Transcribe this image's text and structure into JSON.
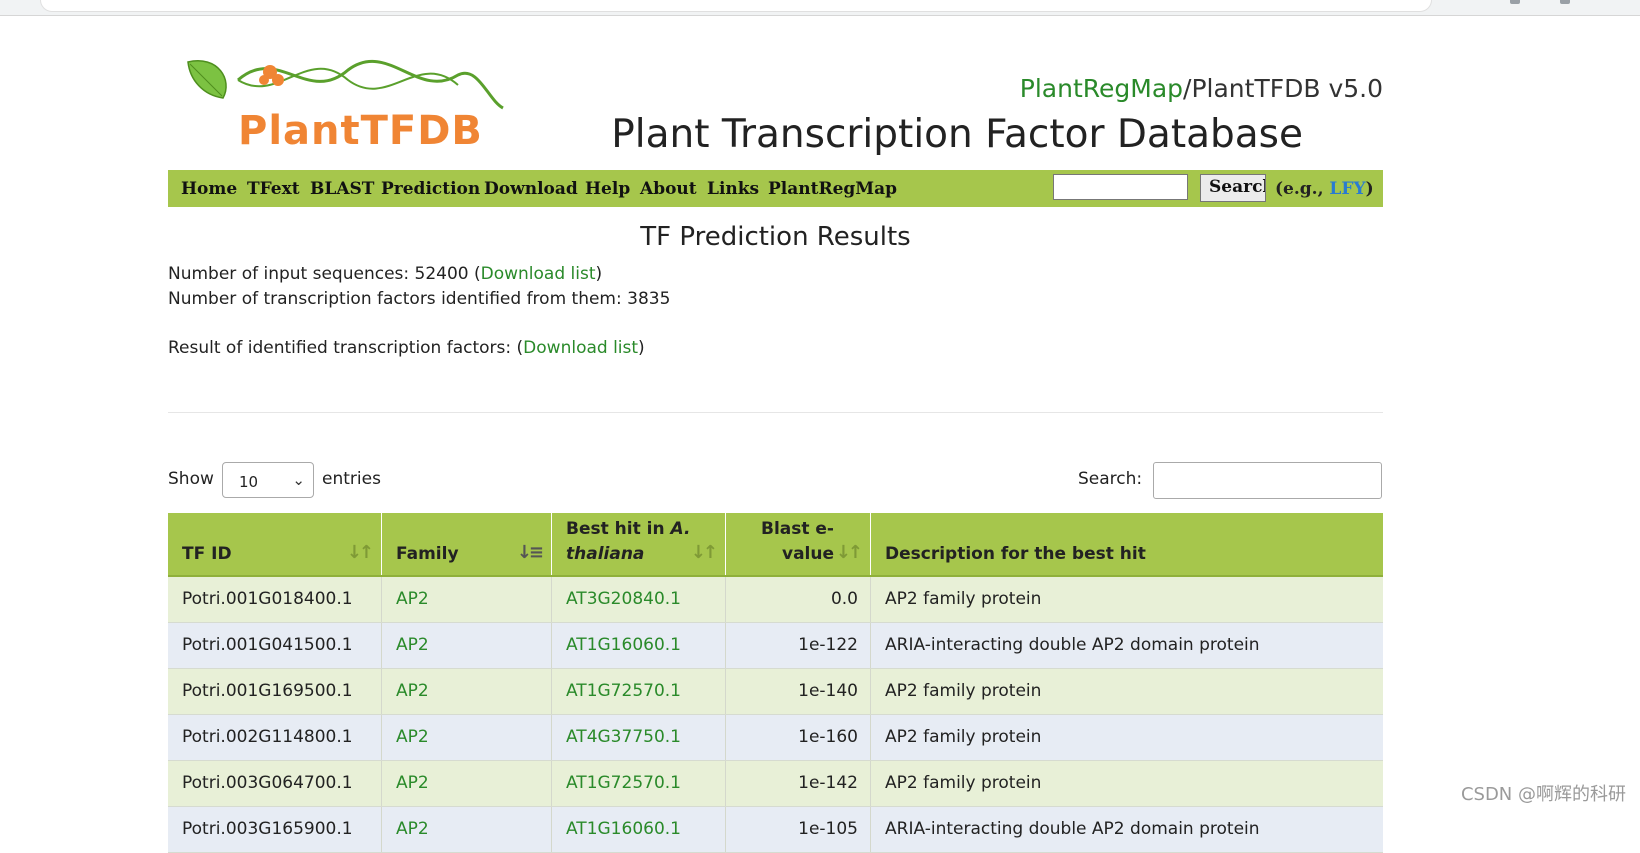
{
  "header": {
    "logo_text": "PlantTFDB",
    "site_link": "PlantRegMap",
    "site_suffix": "/PlantTFDB v5.0",
    "title": "Plant Transcription Factor Database"
  },
  "nav": {
    "items": [
      "Home",
      "TFext",
      "BLAST",
      "Prediction",
      "Download",
      "Help",
      "About",
      "Links",
      "PlantRegMap"
    ],
    "search_button": "Search",
    "example_prefix": "(e.g., ",
    "example_link": "LFY",
    "example_suffix": ")"
  },
  "main": {
    "heading": "TF Prediction Results",
    "input_seq_prefix": "Number of input sequences: 52400 (",
    "download_list": "Download list",
    "close_paren": ")",
    "tf_identified": "Number of transcription factors identified from them: 3835",
    "result_prefix": "Result of identified transcription factors: ("
  },
  "table_controls": {
    "show_label": "Show",
    "entries_value": "10",
    "entries_label": "entries",
    "search_label": "Search:"
  },
  "table": {
    "headers": {
      "tf_id": "TF ID",
      "family": "Family",
      "best_hit_line1": "Best hit in ",
      "best_hit_italic1": "A.",
      "best_hit_italic2": "thaliana",
      "blast_line1": "Blast e-",
      "blast_line2": "value",
      "description": "Description for the best hit"
    },
    "rows": [
      {
        "tf_id": "Potri.001G018400.1",
        "family": "AP2",
        "best_hit": "AT3G20840.1",
        "evalue": "0.0",
        "description": "AP2 family protein"
      },
      {
        "tf_id": "Potri.001G041500.1",
        "family": "AP2",
        "best_hit": "AT1G16060.1",
        "evalue": "1e-122",
        "description": "ARIA-interacting double AP2 domain protein"
      },
      {
        "tf_id": "Potri.001G169500.1",
        "family": "AP2",
        "best_hit": "AT1G72570.1",
        "evalue": "1e-140",
        "description": "AP2 family protein"
      },
      {
        "tf_id": "Potri.002G114800.1",
        "family": "AP2",
        "best_hit": "AT4G37750.1",
        "evalue": "1e-160",
        "description": "AP2 family protein"
      },
      {
        "tf_id": "Potri.003G064700.1",
        "family": "AP2",
        "best_hit": "AT1G72570.1",
        "evalue": "1e-142",
        "description": "AP2 family protein"
      },
      {
        "tf_id": "Potri.003G165900.1",
        "family": "AP2",
        "best_hit": "AT1G16060.1",
        "evalue": "1e-105",
        "description": "ARIA-interacting double AP2 domain protein"
      }
    ]
  },
  "watermark": "CSDN @啊辉的科研",
  "colors": {
    "nav_green": "#a6c64c",
    "link_green": "#2a8a2a",
    "logo_orange": "#f08534",
    "row_odd": "#e8f0d7",
    "row_even": "#e7ecf4"
  }
}
